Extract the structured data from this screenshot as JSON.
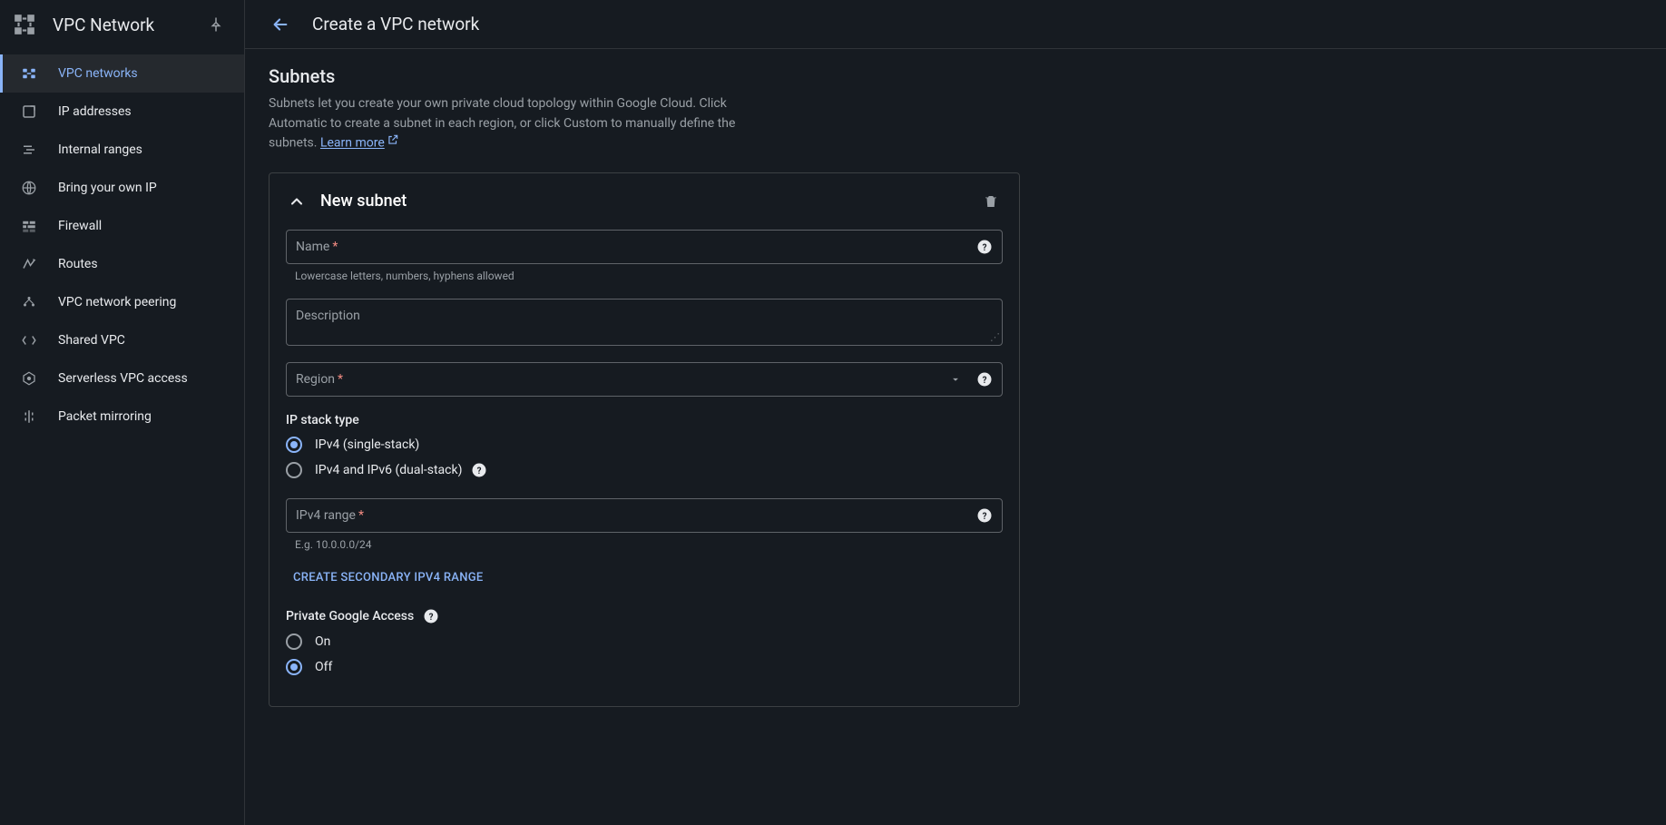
{
  "sidebar": {
    "title": "VPC Network",
    "items": [
      {
        "label": "VPC networks"
      },
      {
        "label": "IP addresses"
      },
      {
        "label": "Internal ranges"
      },
      {
        "label": "Bring your own IP"
      },
      {
        "label": "Firewall"
      },
      {
        "label": "Routes"
      },
      {
        "label": "VPC network peering"
      },
      {
        "label": "Shared VPC"
      },
      {
        "label": "Serverless VPC access"
      },
      {
        "label": "Packet mirroring"
      }
    ]
  },
  "header": {
    "page_title": "Create a VPC network"
  },
  "section": {
    "title": "Subnets",
    "description": "Subnets let you create your own private cloud topology within Google Cloud. Click Automatic to create a subnet in each region, or click Custom to manually define the subnets.",
    "learn_more": "Learn more"
  },
  "subnet": {
    "card_title": "New subnet",
    "name_label": "Name",
    "name_hint": "Lowercase letters, numbers, hyphens allowed",
    "description_label": "Description",
    "region_label": "Region",
    "ip_stack_label": "IP stack type",
    "ip_stack_options": [
      {
        "label": "IPv4 (single-stack)",
        "checked": true
      },
      {
        "label": "IPv4 and IPv6 (dual-stack)",
        "checked": false
      }
    ],
    "ipv4_label": "IPv4 range",
    "ipv4_hint": "E.g. 10.0.0.0/24",
    "secondary_btn": "CREATE SECONDARY IPV4 RANGE",
    "pga_label": "Private Google Access",
    "pga_options": [
      {
        "label": "On",
        "checked": false
      },
      {
        "label": "Off",
        "checked": true
      }
    ]
  }
}
